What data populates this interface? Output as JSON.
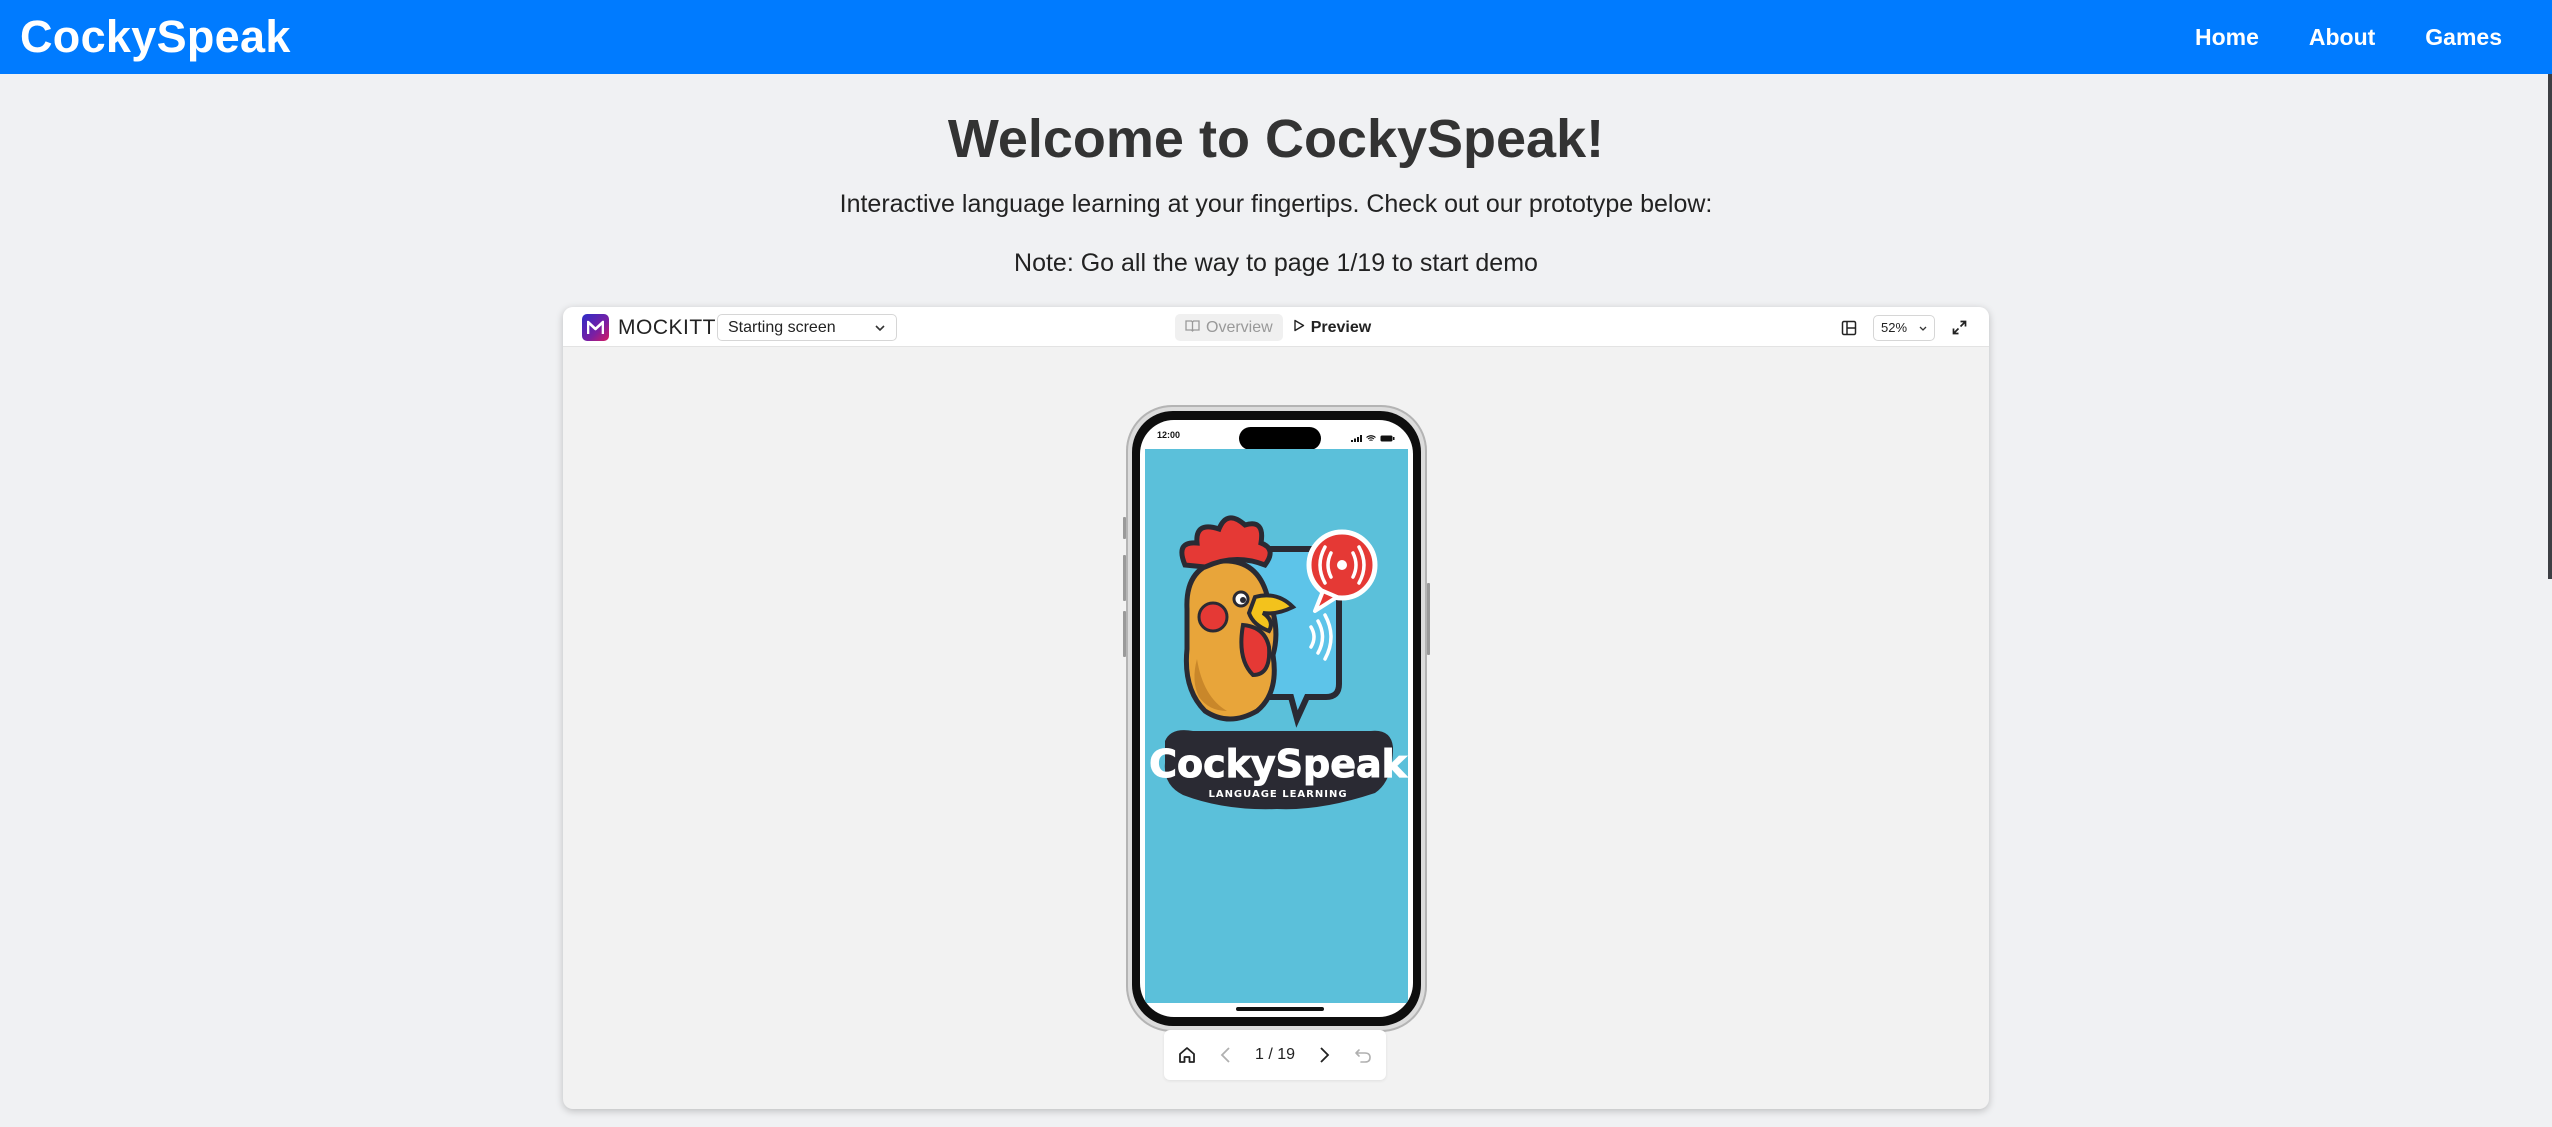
{
  "navbar": {
    "brand": "CockySpeak",
    "links": [
      "Home",
      "About",
      "Games"
    ]
  },
  "hero": {
    "title": "Welcome to CockySpeak!",
    "subtitle": "Interactive language learning at your fingertips. Check out our prototype below:",
    "note": "Note: Go all the way to page 1/19 to start demo"
  },
  "embed": {
    "app_name": "MOCKITT",
    "screen_select": "Starting screen",
    "tabs": {
      "overview": "Overview",
      "preview": "Preview"
    },
    "zoom": "52%",
    "phone": {
      "time": "12:00",
      "logo_title": "CockySpeak",
      "logo_subtitle": "LANGUAGE LEARNING",
      "splash_color": "#5bc0da"
    },
    "pager": {
      "count": "1 / 19"
    }
  },
  "colors": {
    "nav": "#007bff",
    "background": "#f0f1f3",
    "accent_red": "#e53935"
  },
  "icons": [
    "home-icon",
    "chevron-left-icon",
    "chevron-right-icon",
    "undo-icon",
    "book-icon",
    "play-icon",
    "layout-icon",
    "expand-icon",
    "chevron-down-icon"
  ]
}
